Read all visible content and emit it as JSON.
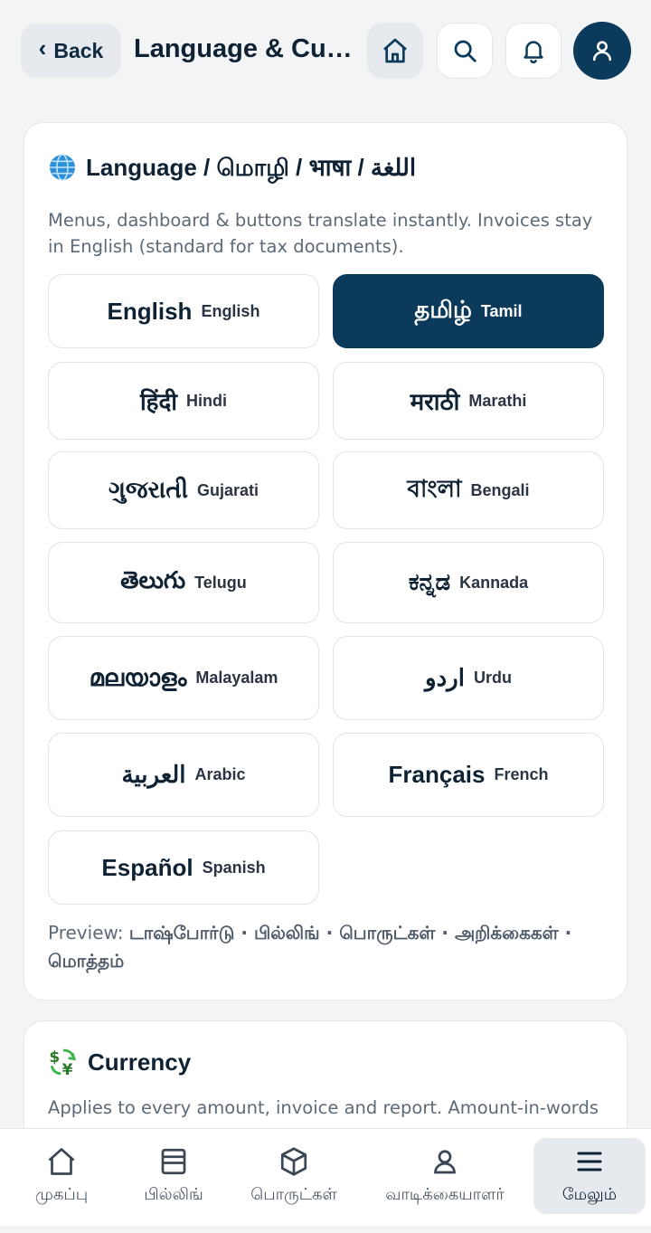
{
  "header": {
    "back_label": "Back",
    "title": "Language & Curr..."
  },
  "language": {
    "title": "Language / மொழி / भाषा / اللغة",
    "description": "Menus, dashboard & buttons translate instantly. Invoices stay in English (standard for tax documents).",
    "options": [
      {
        "native": "English",
        "english": "English",
        "selected": false
      },
      {
        "native": "தமிழ்",
        "english": "Tamil",
        "selected": true
      },
      {
        "native": "हिंदी",
        "english": "Hindi",
        "selected": false
      },
      {
        "native": "मराठी",
        "english": "Marathi",
        "selected": false
      },
      {
        "native": "ગુજરાતી",
        "english": "Gujarati",
        "selected": false
      },
      {
        "native": "বাংলা",
        "english": "Bengali",
        "selected": false
      },
      {
        "native": "తెలుగు",
        "english": "Telugu",
        "selected": false
      },
      {
        "native": "ಕನ್ನಡ",
        "english": "Kannada",
        "selected": false
      },
      {
        "native": "മലയാളം",
        "english": "Malayalam",
        "selected": false
      },
      {
        "native": "اردو",
        "english": "Urdu",
        "selected": false
      },
      {
        "native": "العربية",
        "english": "Arabic",
        "selected": false
      },
      {
        "native": "Français",
        "english": "French",
        "selected": false
      },
      {
        "native": "Español",
        "english": "Spanish",
        "selected": false
      }
    ],
    "preview_label": "Preview:",
    "preview_value": "டாஷ்போர்டு · பில்லிங் · பொருட்கள் · அறிக்கைகள் · மொத்தம்"
  },
  "currency": {
    "title": "Currency",
    "description": "Applies to every amount, invoice and report. Amount-in-words"
  },
  "nav": {
    "items": [
      {
        "label": "முகப்பு",
        "icon": "home-icon"
      },
      {
        "label": "பில்லிங்",
        "icon": "billing-icon"
      },
      {
        "label": "பொருட்கள்",
        "icon": "box-icon"
      },
      {
        "label": "வாடிக்கையாளர்",
        "icon": "customer-icon"
      },
      {
        "label": "மேலும்",
        "icon": "menu-icon"
      }
    ]
  },
  "colors": {
    "accent": "#0b3a5b",
    "background": "#f2f4f6"
  }
}
